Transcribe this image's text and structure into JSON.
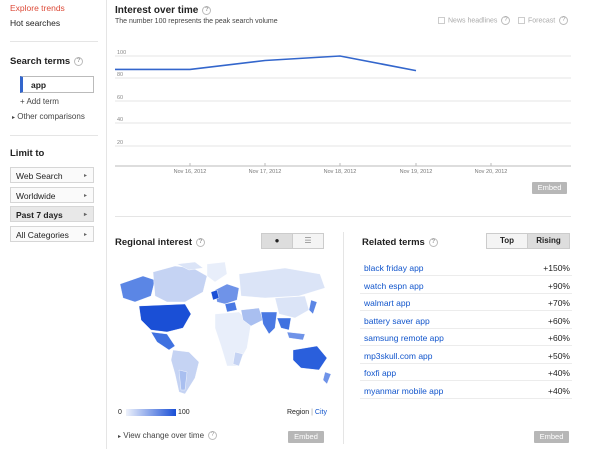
{
  "sidebar": {
    "explore_trends": "Explore trends",
    "hot_searches": "Hot searches",
    "search_terms_heading": "Search terms",
    "term": "app",
    "add_term": "+ Add term",
    "other_comparisons": "Other comparisons",
    "limit_to_heading": "Limit to",
    "filters": [
      "Web Search",
      "Worldwide",
      "Past 7 days",
      "All Categories"
    ]
  },
  "interest": {
    "title": "Interest over time",
    "subtitle": "The number 100 represents the peak search volume",
    "news_headlines": "News headlines",
    "forecast": "Forecast",
    "embed": "Embed"
  },
  "chart_data": {
    "type": "line",
    "title": "",
    "xlabel": "",
    "ylabel": "",
    "y_ticks": [
      "100",
      "80",
      "60",
      "40",
      "20"
    ],
    "x_ticks": [
      "Nov 16, 2012",
      "Nov 17, 2012",
      "Nov 18, 2012",
      "Nov 19, 2012",
      "Nov 20, 2012"
    ],
    "ylim": [
      0,
      100
    ],
    "series": [
      {
        "x": [
          0,
          1,
          2,
          3,
          4,
          5
        ],
        "values": [
          88,
          88,
          96,
          100,
          87,
          null
        ]
      }
    ],
    "color": "#3366cc",
    "grid": true
  },
  "regional": {
    "title": "Regional interest",
    "scale_min": "0",
    "scale_max": "100",
    "region": "Region",
    "city": "City",
    "view_change": "View change over time",
    "embed": "Embed"
  },
  "related": {
    "title": "Related terms",
    "top": "Top",
    "rising": "Rising",
    "rows": [
      {
        "term": "black friday app",
        "value": "+150%"
      },
      {
        "term": "watch espn app",
        "value": "+90%"
      },
      {
        "term": "walmart app",
        "value": "+70%"
      },
      {
        "term": "battery saver app",
        "value": "+60%"
      },
      {
        "term": "samsung remote app",
        "value": "+60%"
      },
      {
        "term": "mp3skull.com app",
        "value": "+50%"
      },
      {
        "term": "foxfi app",
        "value": "+40%"
      },
      {
        "term": "myanmar mobile app",
        "value": "+40%"
      }
    ],
    "embed": "Embed"
  }
}
